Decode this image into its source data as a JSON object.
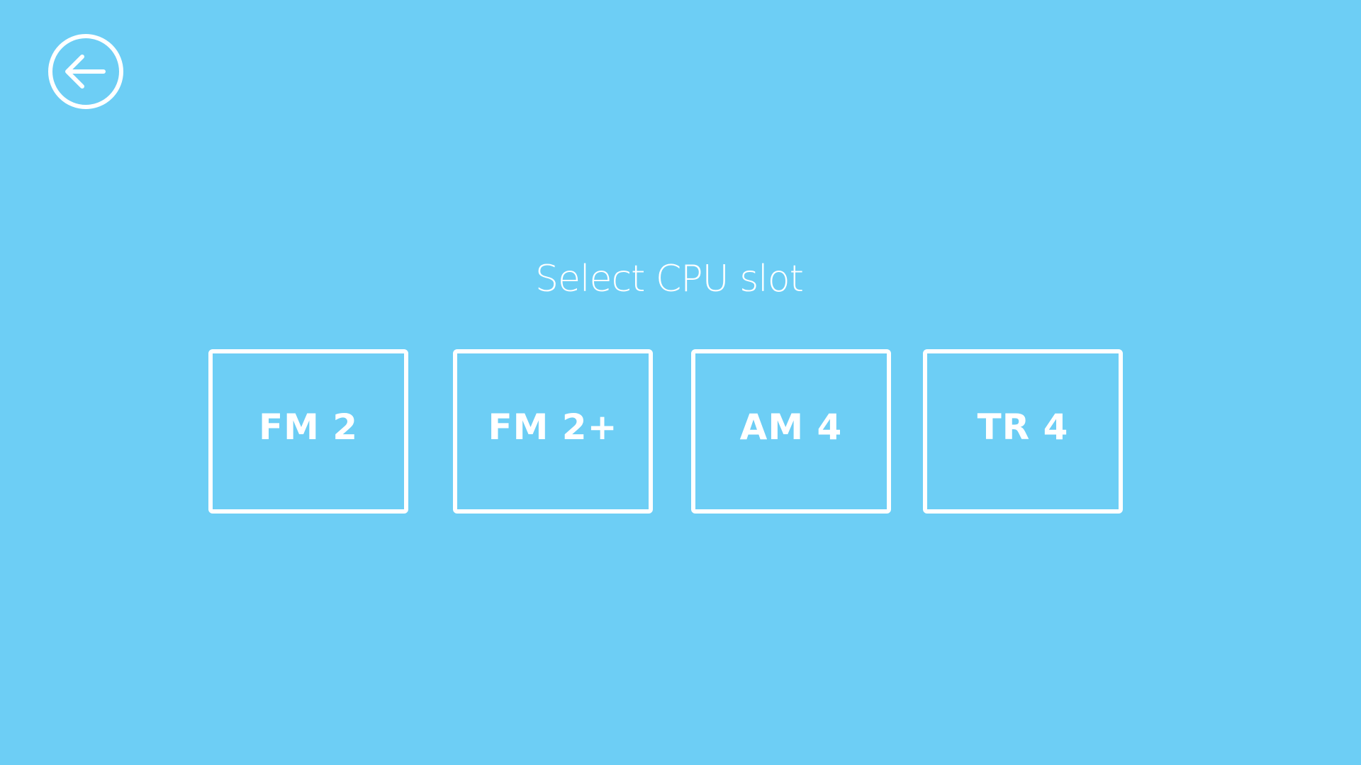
{
  "background_color": "#6dcef5",
  "foreground_color": "#ffffff",
  "back_button": {
    "icon": "arrow-left-circle-icon"
  },
  "title": "Select CPU slot",
  "slots": [
    {
      "label": "FM 2"
    },
    {
      "label": "FM 2+"
    },
    {
      "label": "AM 4"
    },
    {
      "label": "TR 4"
    }
  ]
}
